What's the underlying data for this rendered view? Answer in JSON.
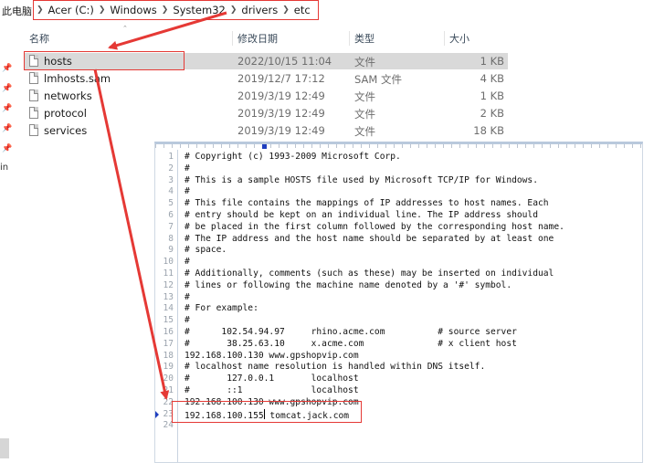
{
  "address_bar": {
    "root": "此电脑",
    "crumbs": [
      "Acer (C:)",
      "Windows",
      "System32",
      "drivers",
      "etc"
    ]
  },
  "columns": {
    "name": "名称",
    "modified": "修改日期",
    "type": "类型",
    "size": "大小"
  },
  "files": [
    {
      "name": "hosts",
      "modified": "2022/10/15 11:04",
      "type": "文件",
      "size": "1 KB",
      "selected": true
    },
    {
      "name": "lmhosts.sam",
      "modified": "2019/12/7 17:12",
      "type": "SAM 文件",
      "size": "4 KB",
      "selected": false
    },
    {
      "name": "networks",
      "modified": "2019/3/19 12:49",
      "type": "文件",
      "size": "1 KB",
      "selected": false
    },
    {
      "name": "protocol",
      "modified": "2019/3/19 12:49",
      "type": "文件",
      "size": "2 KB",
      "selected": false
    },
    {
      "name": "services",
      "modified": "2019/3/19 12:49",
      "type": "文件",
      "size": "18 KB",
      "selected": false
    }
  ],
  "sidebar_fragment": "in",
  "editor": {
    "lines": [
      "# Copyright (c) 1993-2009 Microsoft Corp.",
      "#",
      "# This is a sample HOSTS file used by Microsoft TCP/IP for Windows.",
      "#",
      "# This file contains the mappings of IP addresses to host names. Each",
      "# entry should be kept on an individual line. The IP address should",
      "# be placed in the first column followed by the corresponding host name.",
      "# The IP address and the host name should be separated by at least one",
      "# space.",
      "#",
      "# Additionally, comments (such as these) may be inserted on individual",
      "# lines or following the machine name denoted by a '#' symbol.",
      "#",
      "# For example:",
      "#",
      "#      102.54.94.97     rhino.acme.com          # source server",
      "#       38.25.63.10     x.acme.com              # x client host",
      "192.168.100.130 www.gpshopvip.com",
      "# localhost name resolution is handled within DNS itself.",
      "#       127.0.0.1       localhost",
      "#       ::1             localhost",
      "192.168.100.130 www.gpshopvip.com",
      "192.168.100.155 tomcat.jack.com",
      ""
    ],
    "current_line": 23
  }
}
